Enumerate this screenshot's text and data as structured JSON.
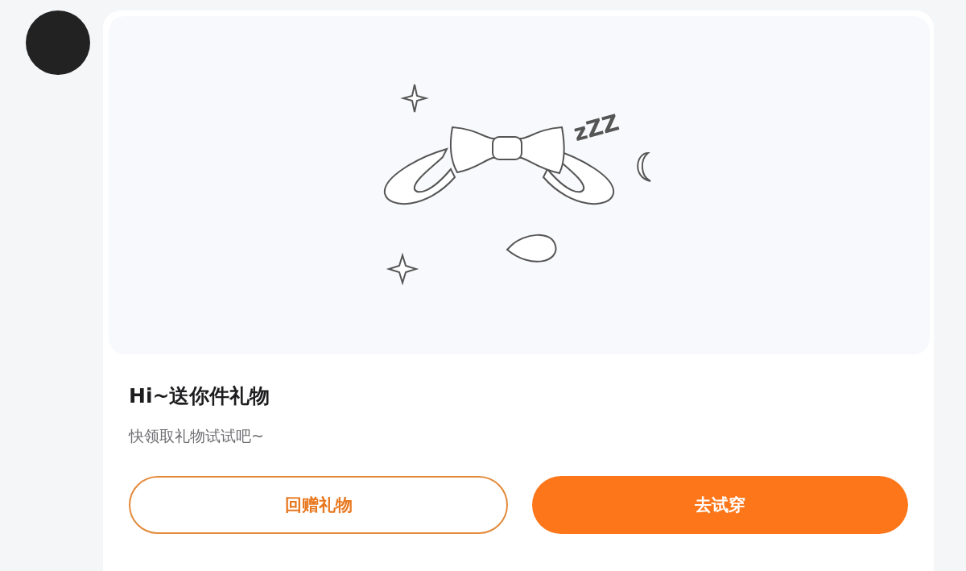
{
  "gift_card": {
    "sticker_text": "zZZ",
    "title": "Hi~送你件礼物",
    "subtitle": "快领取礼物试试吧~",
    "buttons": [
      {
        "label": "回赠礼物",
        "kind": "outline"
      },
      {
        "label": "去试穿",
        "kind": "filled"
      }
    ]
  }
}
